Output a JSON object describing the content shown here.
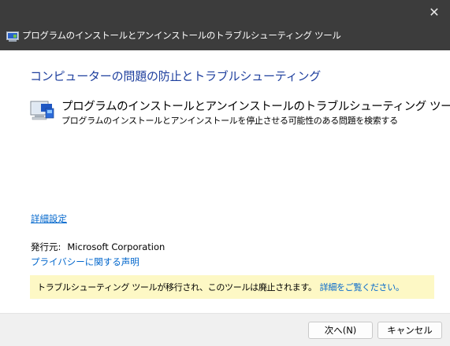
{
  "window": {
    "title": "プログラムのインストールとアンインストールのトラブルシューティング ツール",
    "close_glyph": "✕"
  },
  "main": {
    "heading": "コンピューターの問題の防止とトラブルシューティング",
    "tool_icon": "computer-with-installer-icon",
    "tool_title": "プログラムのインストールとアンインストールのトラブルシューティング ツール",
    "tool_description": "プログラムのインストールとアンインストールを停止させる可能性のある問題を検索する",
    "advanced_link": "詳細設定",
    "publisher_label": "発行元:",
    "publisher_value": "Microsoft Corporation",
    "privacy_link": "プライバシーに関する声明",
    "notice_text": "トラブルシューティング ツールが移行され、このツールは廃止されます。",
    "notice_link": "詳細をご覧ください。"
  },
  "footer": {
    "next_button": "次へ(N)",
    "cancel_button": "キャンセル"
  },
  "colors": {
    "titlebar": "#3c3c3c",
    "heading": "#1e3f9e",
    "link": "#0066cc",
    "notice_bg": "#fdf8c5",
    "footer_bg": "#f0f0f0"
  }
}
